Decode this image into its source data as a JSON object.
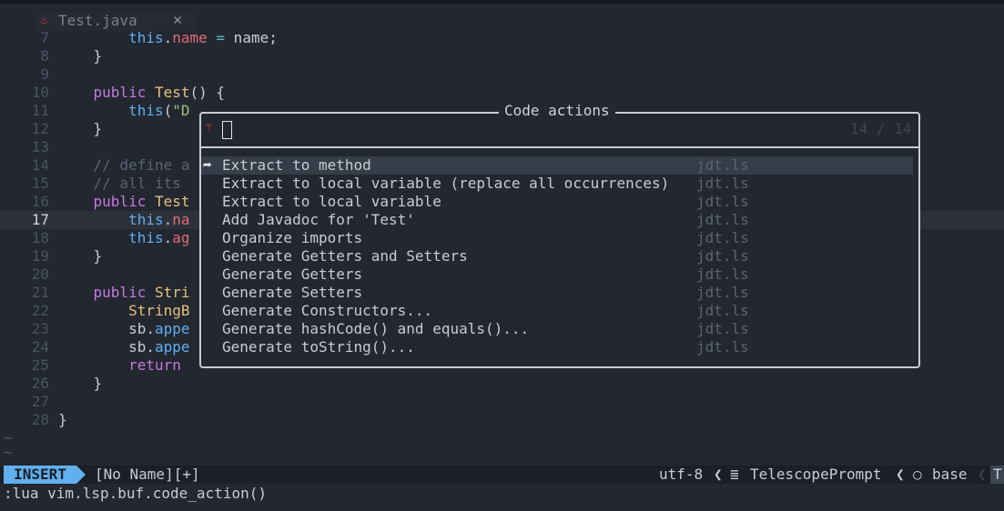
{
  "tab": {
    "name": "Test.java",
    "icon": "java-icon",
    "close": "✕"
  },
  "editor": {
    "lines": [
      {
        "n": "7",
        "t": 42,
        "html": "        <span class=\"th\">this</span>.<span class=\"pr\">name</span> <span class=\"op\">=</span> name;"
      },
      {
        "n": "8",
        "t": 62,
        "html": "    }"
      },
      {
        "n": "9",
        "t": 82,
        "html": ""
      },
      {
        "n": "10",
        "t": 102,
        "html": "    <span class=\"kw\">public</span> <span class=\"fn\">Test</span>() {"
      },
      {
        "n": "11",
        "t": 122,
        "html": "        <span class=\"th\">this</span>(<span class=\"st\">\"D</span>"
      },
      {
        "n": "12",
        "t": 142,
        "html": "    }"
      },
      {
        "n": "13",
        "t": 162,
        "html": ""
      },
      {
        "n": "14",
        "t": 182,
        "html": "    <span class=\"cm\">// define a</span>"
      },
      {
        "n": "15",
        "t": 202,
        "html": "    <span class=\"cm\">// all its</span>"
      },
      {
        "n": "16",
        "t": 222,
        "html": "    <span class=\"kw\">public</span> <span class=\"fn\">Test</span>"
      },
      {
        "n": "17",
        "t": 242,
        "html": "        <span class=\"th\">this</span>.<span class=\"pr\">na</span>",
        "cur": true
      },
      {
        "n": "18",
        "t": 262,
        "html": "        <span class=\"th\">this</span>.<span class=\"pr\">ag</span>"
      },
      {
        "n": "19",
        "t": 282,
        "html": "    }"
      },
      {
        "n": "20",
        "t": 302,
        "html": ""
      },
      {
        "n": "21",
        "t": 322,
        "html": "    <span class=\"kw\">public</span> <span class=\"fn\">Stri</span>"
      },
      {
        "n": "22",
        "t": 342,
        "html": "        <span class=\"fn\">StringB</span>"
      },
      {
        "n": "23",
        "t": 362,
        "html": "        sb.<span class=\"th\">appe</span>"
      },
      {
        "n": "24",
        "t": 382,
        "html": "        sb.<span class=\"th\">appe</span>"
      },
      {
        "n": "25",
        "t": 402,
        "html": "        <span class=\"kw\">return</span>"
      },
      {
        "n": "26",
        "t": 422,
        "html": "    }"
      },
      {
        "n": "27",
        "t": 442,
        "html": ""
      },
      {
        "n": "28",
        "t": 462,
        "html": "}"
      }
    ],
    "tildes": [
      {
        "t": 482,
        "v": "~"
      },
      {
        "t": 498,
        "v": "~"
      }
    ]
  },
  "popup": {
    "title": "Code actions",
    "prompt_icon": "telescope-icon",
    "counter": "14 / 14",
    "results": [
      {
        "title": "Extract to method",
        "client": "jdt.ls"
      },
      {
        "title": "Extract to local variable (replace all occurrences)",
        "client": "jdt.ls"
      },
      {
        "title": "Extract to local variable",
        "client": "jdt.ls"
      },
      {
        "title": "Add Javadoc for 'Test'",
        "client": "jdt.ls"
      },
      {
        "title": "Organize imports",
        "client": "jdt.ls"
      },
      {
        "title": "Generate Getters and Setters",
        "client": "jdt.ls"
      },
      {
        "title": "Generate Getters",
        "client": "jdt.ls"
      },
      {
        "title": "Generate Setters",
        "client": "jdt.ls"
      },
      {
        "title": "Generate Constructors...",
        "client": "jdt.ls"
      },
      {
        "title": "Generate hashCode() and equals()...",
        "client": "jdt.ls"
      },
      {
        "title": "Generate toString()...",
        "client": "jdt.ls"
      }
    ],
    "selected_caret": "➦"
  },
  "statusline": {
    "mode": "INSERT",
    "filename": "[No Name][+]",
    "encoding": "utf-8",
    "separator": "❮",
    "filetype_icon": "≣",
    "filetype": "TelescopePrompt",
    "branch_icon": "○",
    "branch": "base",
    "truncated": "T"
  },
  "cmdline": ":lua vim.lsp.buf.code_action()",
  "colors": {
    "background": "#222730",
    "accent": "#61afef",
    "keyword": "#c678dd",
    "type": "#e5c07b",
    "property": "#e06c75",
    "string": "#98c379",
    "comment": "#5c6370"
  }
}
